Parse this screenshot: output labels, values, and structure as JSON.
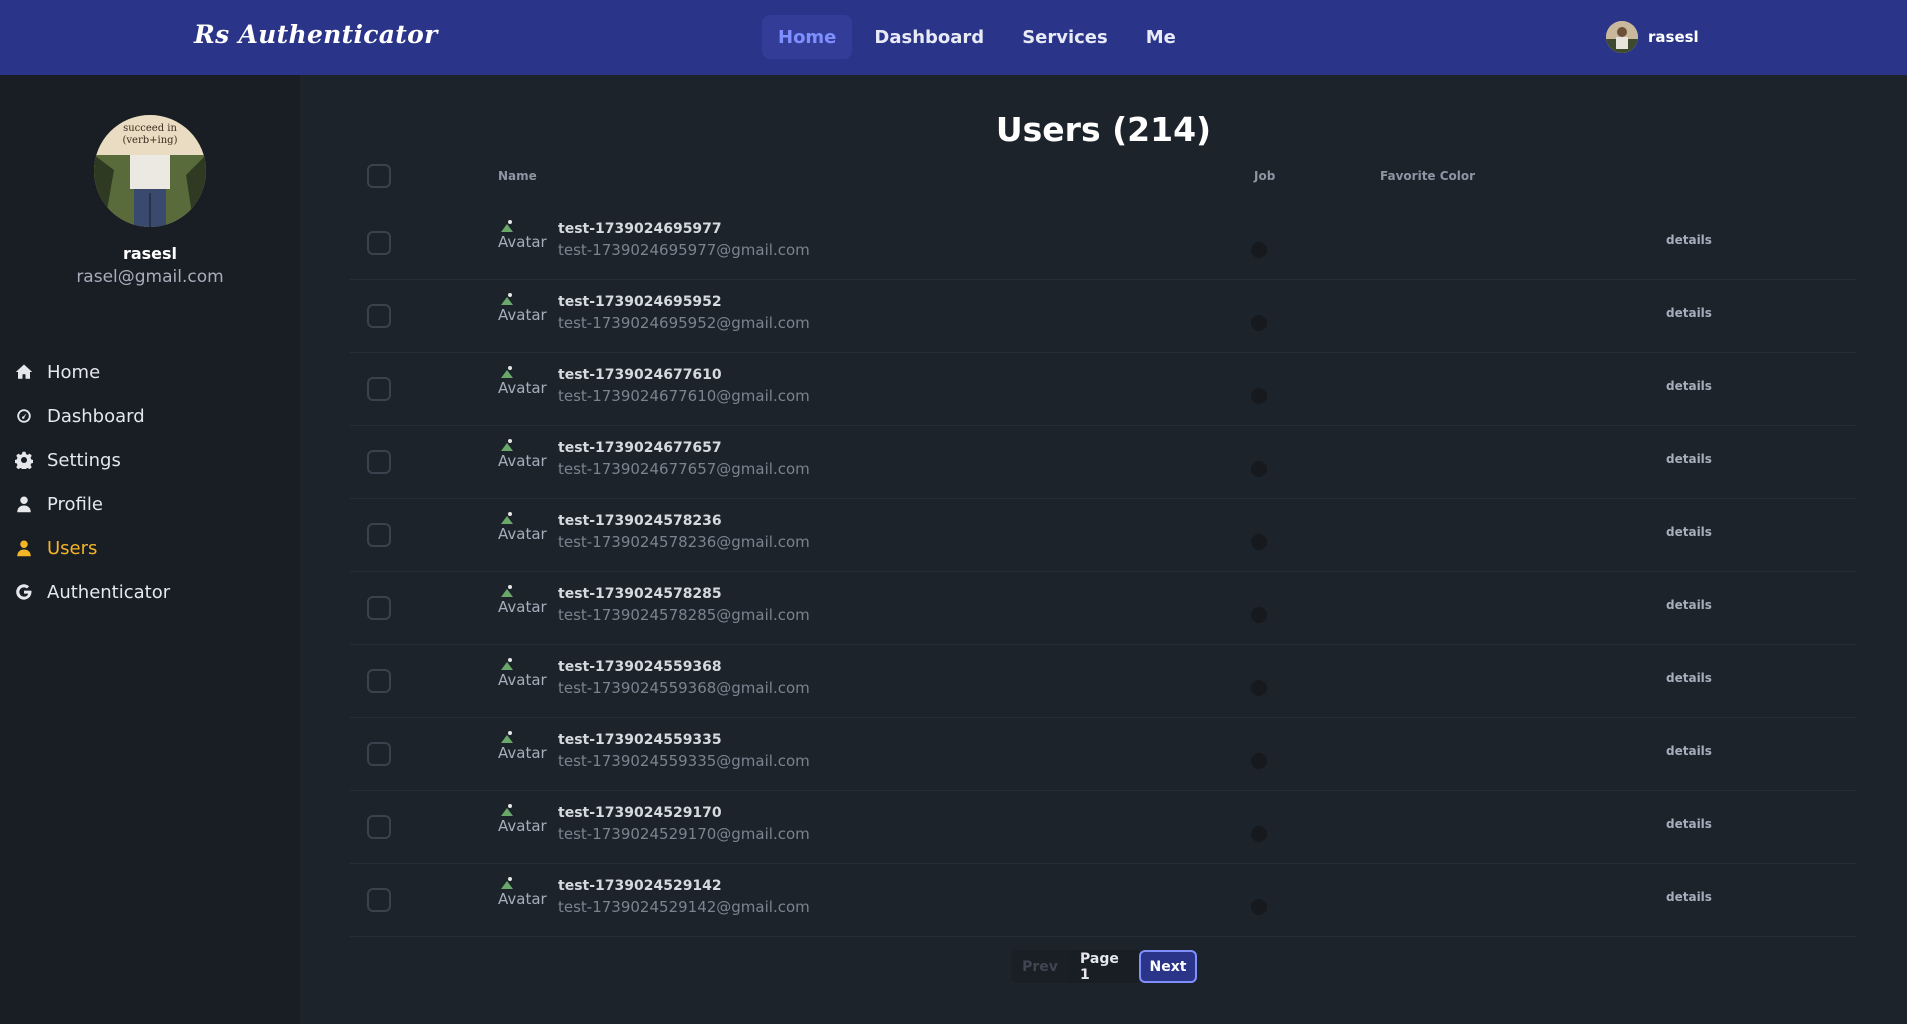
{
  "brand": "Rs Authenticator",
  "nav": [
    "Home",
    "Dashboard",
    "Services",
    "Me"
  ],
  "nav_active": "Home",
  "current_user": {
    "username": "rasesl",
    "email": "rasel@gmail.com"
  },
  "profile_avatar_text": "succeed in (verb+ing)",
  "sidebar": {
    "items": [
      {
        "label": "Home",
        "icon": "home-icon"
      },
      {
        "label": "Dashboard",
        "icon": "gauge-icon"
      },
      {
        "label": "Settings",
        "icon": "gear-icon"
      },
      {
        "label": "Profile",
        "icon": "user-icon"
      },
      {
        "label": "Users",
        "icon": "user-icon",
        "active": true
      },
      {
        "label": "Authenticator",
        "icon": "google-icon"
      }
    ]
  },
  "page_title": "Users (214)",
  "table": {
    "columns": {
      "name": "Name",
      "job": "Job",
      "favorite_color": "Favorite Color"
    },
    "avatar_alt": "Avatar",
    "details_label": "details",
    "rows": [
      {
        "name": "test-1739024695977",
        "email": "test-1739024695977@gmail.com"
      },
      {
        "name": "test-1739024695952",
        "email": "test-1739024695952@gmail.com"
      },
      {
        "name": "test-1739024677610",
        "email": "test-1739024677610@gmail.com"
      },
      {
        "name": "test-1739024677657",
        "email": "test-1739024677657@gmail.com"
      },
      {
        "name": "test-1739024578236",
        "email": "test-1739024578236@gmail.com"
      },
      {
        "name": "test-1739024578285",
        "email": "test-1739024578285@gmail.com"
      },
      {
        "name": "test-1739024559368",
        "email": "test-1739024559368@gmail.com"
      },
      {
        "name": "test-1739024559335",
        "email": "test-1739024559335@gmail.com"
      },
      {
        "name": "test-1739024529170",
        "email": "test-1739024529170@gmail.com"
      },
      {
        "name": "test-1739024529142",
        "email": "test-1739024529142@gmail.com"
      }
    ]
  },
  "pagination": {
    "prev": "Prev",
    "page": "Page 1",
    "next": "Next"
  },
  "colors": {
    "navbar": "#2a3489",
    "accent": "#7f8fff",
    "active_menu": "#f6b526",
    "background": "#1d232a",
    "sidebar": "#191e24"
  }
}
